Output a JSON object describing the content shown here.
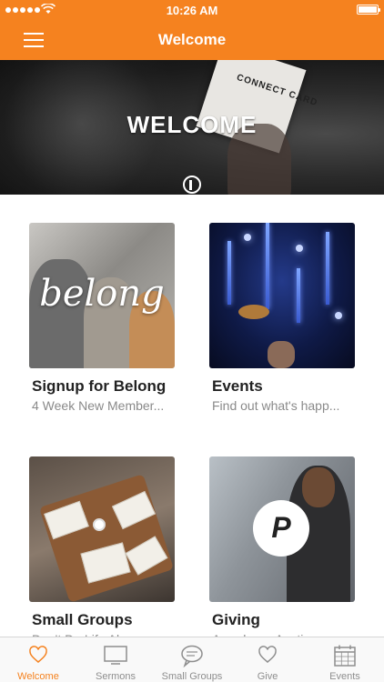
{
  "status_bar": {
    "time": "10:26 AM"
  },
  "nav": {
    "title": "Welcome"
  },
  "hero": {
    "title": "WELCOME",
    "card_text": "CONNECT CARD"
  },
  "tiles": [
    {
      "title": "Signup for Belong",
      "subtitle": "4 Week New Member...",
      "image_overlay_text": "belong"
    },
    {
      "title": "Events",
      "subtitle": "Find out what's happ..."
    },
    {
      "title": "Small Groups",
      "subtitle": "Don't Do Life Alone"
    },
    {
      "title": "Giving",
      "subtitle": "Anywhere, Anytime",
      "image_overlay_text": "P"
    }
  ],
  "tabbar": {
    "items": [
      {
        "label": "Welcome",
        "icon": "heart-icon",
        "active": true
      },
      {
        "label": "Sermons",
        "icon": "tv-icon",
        "active": false
      },
      {
        "label": "Small Groups",
        "icon": "chat-bubble-icon",
        "active": false
      },
      {
        "label": "Give",
        "icon": "heart-icon",
        "active": false
      },
      {
        "label": "Events",
        "icon": "calendar-icon",
        "active": false
      }
    ]
  },
  "colors": {
    "brand": "#f5821f",
    "tab_inactive": "#8e8e8e"
  }
}
